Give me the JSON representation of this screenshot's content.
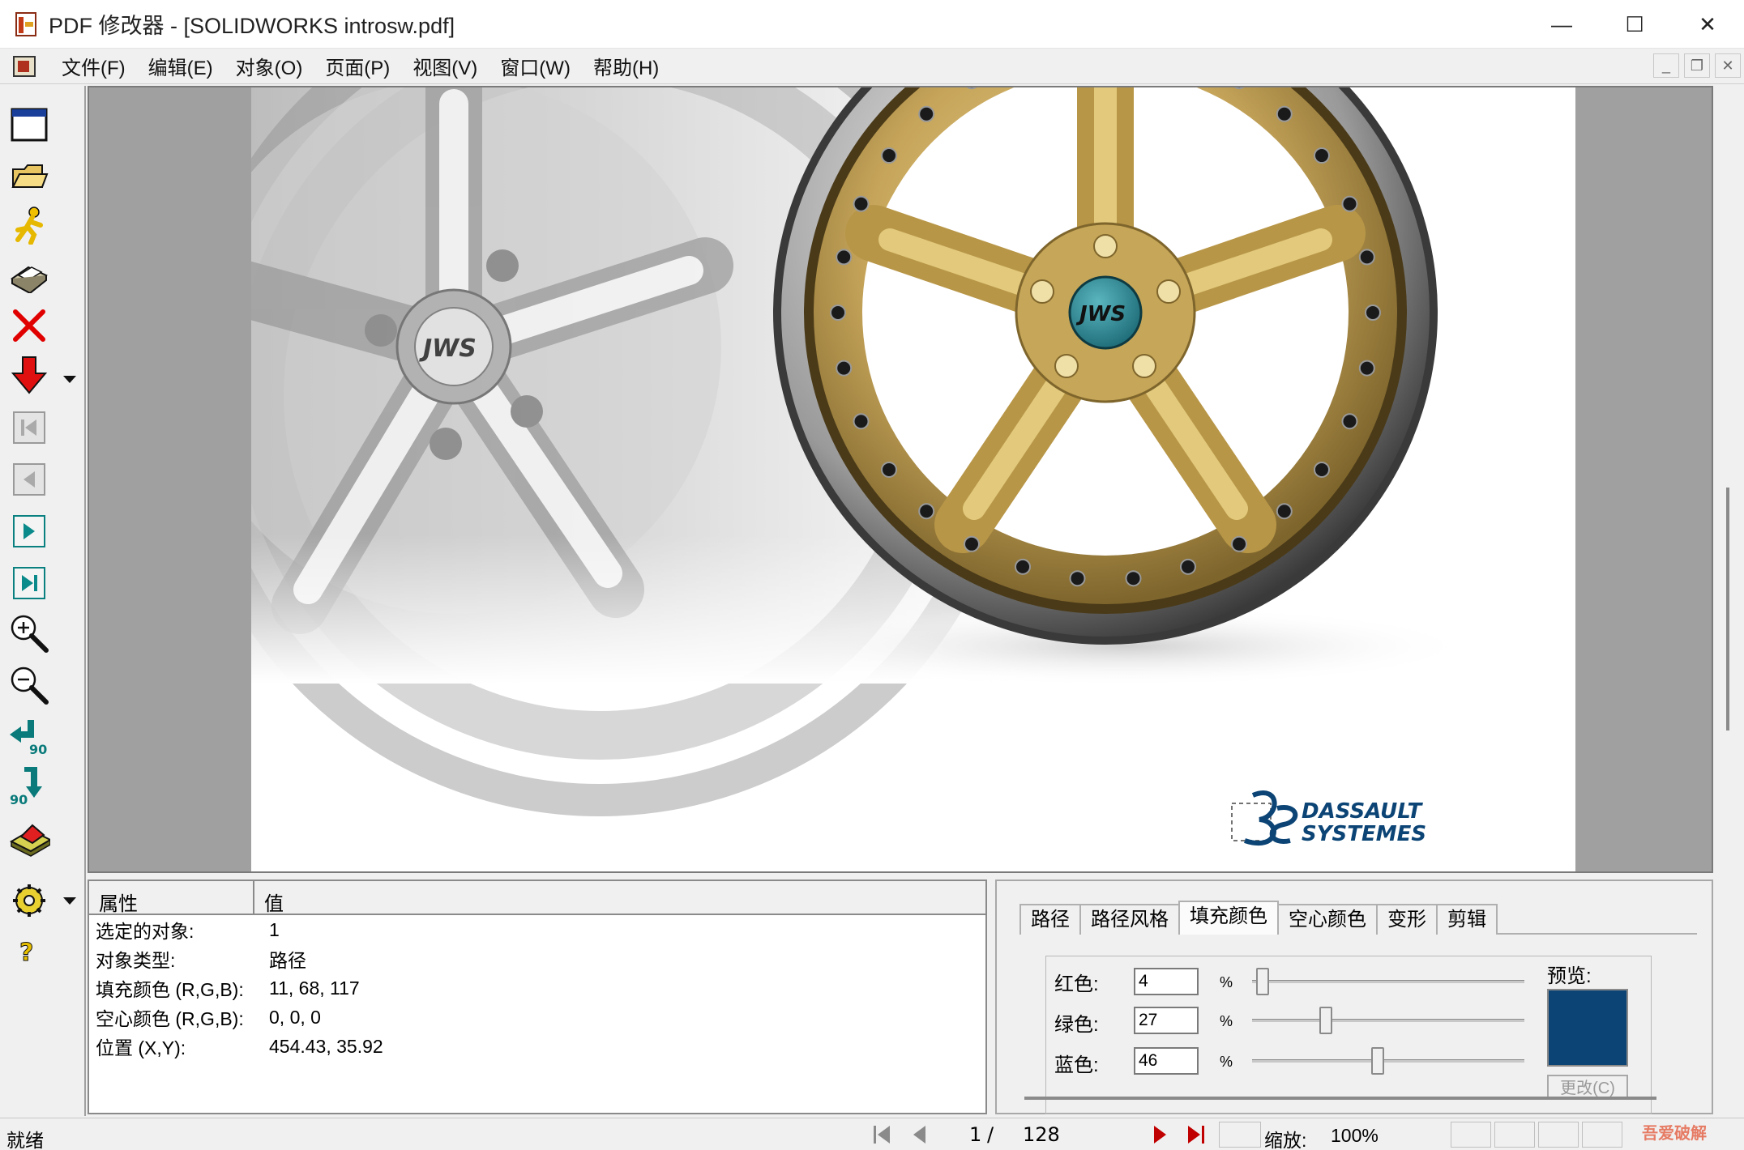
{
  "window": {
    "title": "PDF 修改器 - [SOLIDWORKS introsw.pdf]",
    "minimize": "—",
    "maximize": "☐",
    "close": "✕"
  },
  "menu": {
    "items": [
      "文件(F)",
      "编辑(E)",
      "对象(O)",
      "页面(P)",
      "视图(V)",
      "窗口(W)",
      "帮助(H)"
    ]
  },
  "document": {
    "logo_line1": "DASSAULT",
    "logo_line2": "SYSTEMES",
    "hub_text": "JWS"
  },
  "properties": {
    "col_property": "属性",
    "col_value": "值",
    "rows": [
      {
        "key": "选定的对象:",
        "value": "1"
      },
      {
        "key": "对象类型:",
        "value": "路径"
      },
      {
        "key": "填充颜色 (R,G,B):",
        "value": "11, 68, 117"
      },
      {
        "key": "空心颜色 (R,G,B):",
        "value": "0, 0, 0"
      },
      {
        "key": "位置 (X,Y):",
        "value": "454.43, 35.92"
      }
    ]
  },
  "edit_panel": {
    "tabs": [
      "路径",
      "路径风格",
      "填充颜色",
      "空心颜色",
      "变形",
      "剪辑"
    ],
    "active_tab": "填充颜色",
    "red_label": "红色:",
    "green_label": "绿色:",
    "blue_label": "蓝色:",
    "red_value": "4",
    "green_value": "27",
    "blue_value": "46",
    "percent": "%",
    "preview_label": "预览:",
    "apply_label": "更改(C)",
    "preview_color": "#0b4475"
  },
  "status": {
    "text": "就绪",
    "current_page": "1",
    "separator": "/",
    "total_pages": "128",
    "zoom_label": "缩放:",
    "zoom_value": "100%",
    "watermark": "吾爱破解"
  }
}
